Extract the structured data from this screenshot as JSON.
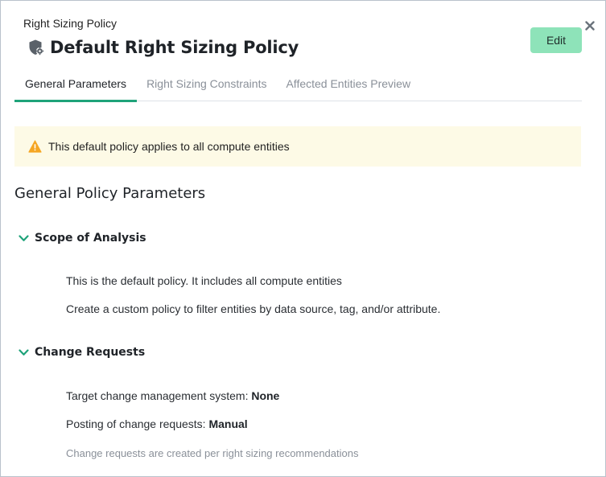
{
  "header": {
    "breadcrumb": "Right Sizing Policy",
    "title": "Default Right Sizing Policy",
    "edit_label": "Edit"
  },
  "tabs": [
    {
      "label": "General Parameters",
      "active": true
    },
    {
      "label": "Right Sizing Constraints",
      "active": false
    },
    {
      "label": "Affected Entities Preview",
      "active": false
    }
  ],
  "notice": {
    "text": "This default policy applies to all compute entities"
  },
  "main": {
    "section_title": "General Policy Parameters",
    "scope": {
      "title": "Scope of Analysis",
      "line1": "This is the default policy. It includes all compute entities",
      "line2": "Create a custom policy to filter entities by data source, tag, and/or attribute."
    },
    "change_requests": {
      "title": "Change Requests",
      "target_label": "Target change management system: ",
      "target_value": "None",
      "posting_label": "Posting of change requests: ",
      "posting_value": "Manual",
      "note": "Change requests are created per right sizing recommendations"
    }
  },
  "colors": {
    "accent": "#1fa37a",
    "edit_button": "#8ee3b9",
    "notice_bg": "#fdfae6",
    "warning": "#f5a623"
  },
  "icons": {
    "close": "close-icon",
    "title": "shield-gear-icon",
    "warning": "warning-icon",
    "chevron": "chevron-down-icon"
  }
}
